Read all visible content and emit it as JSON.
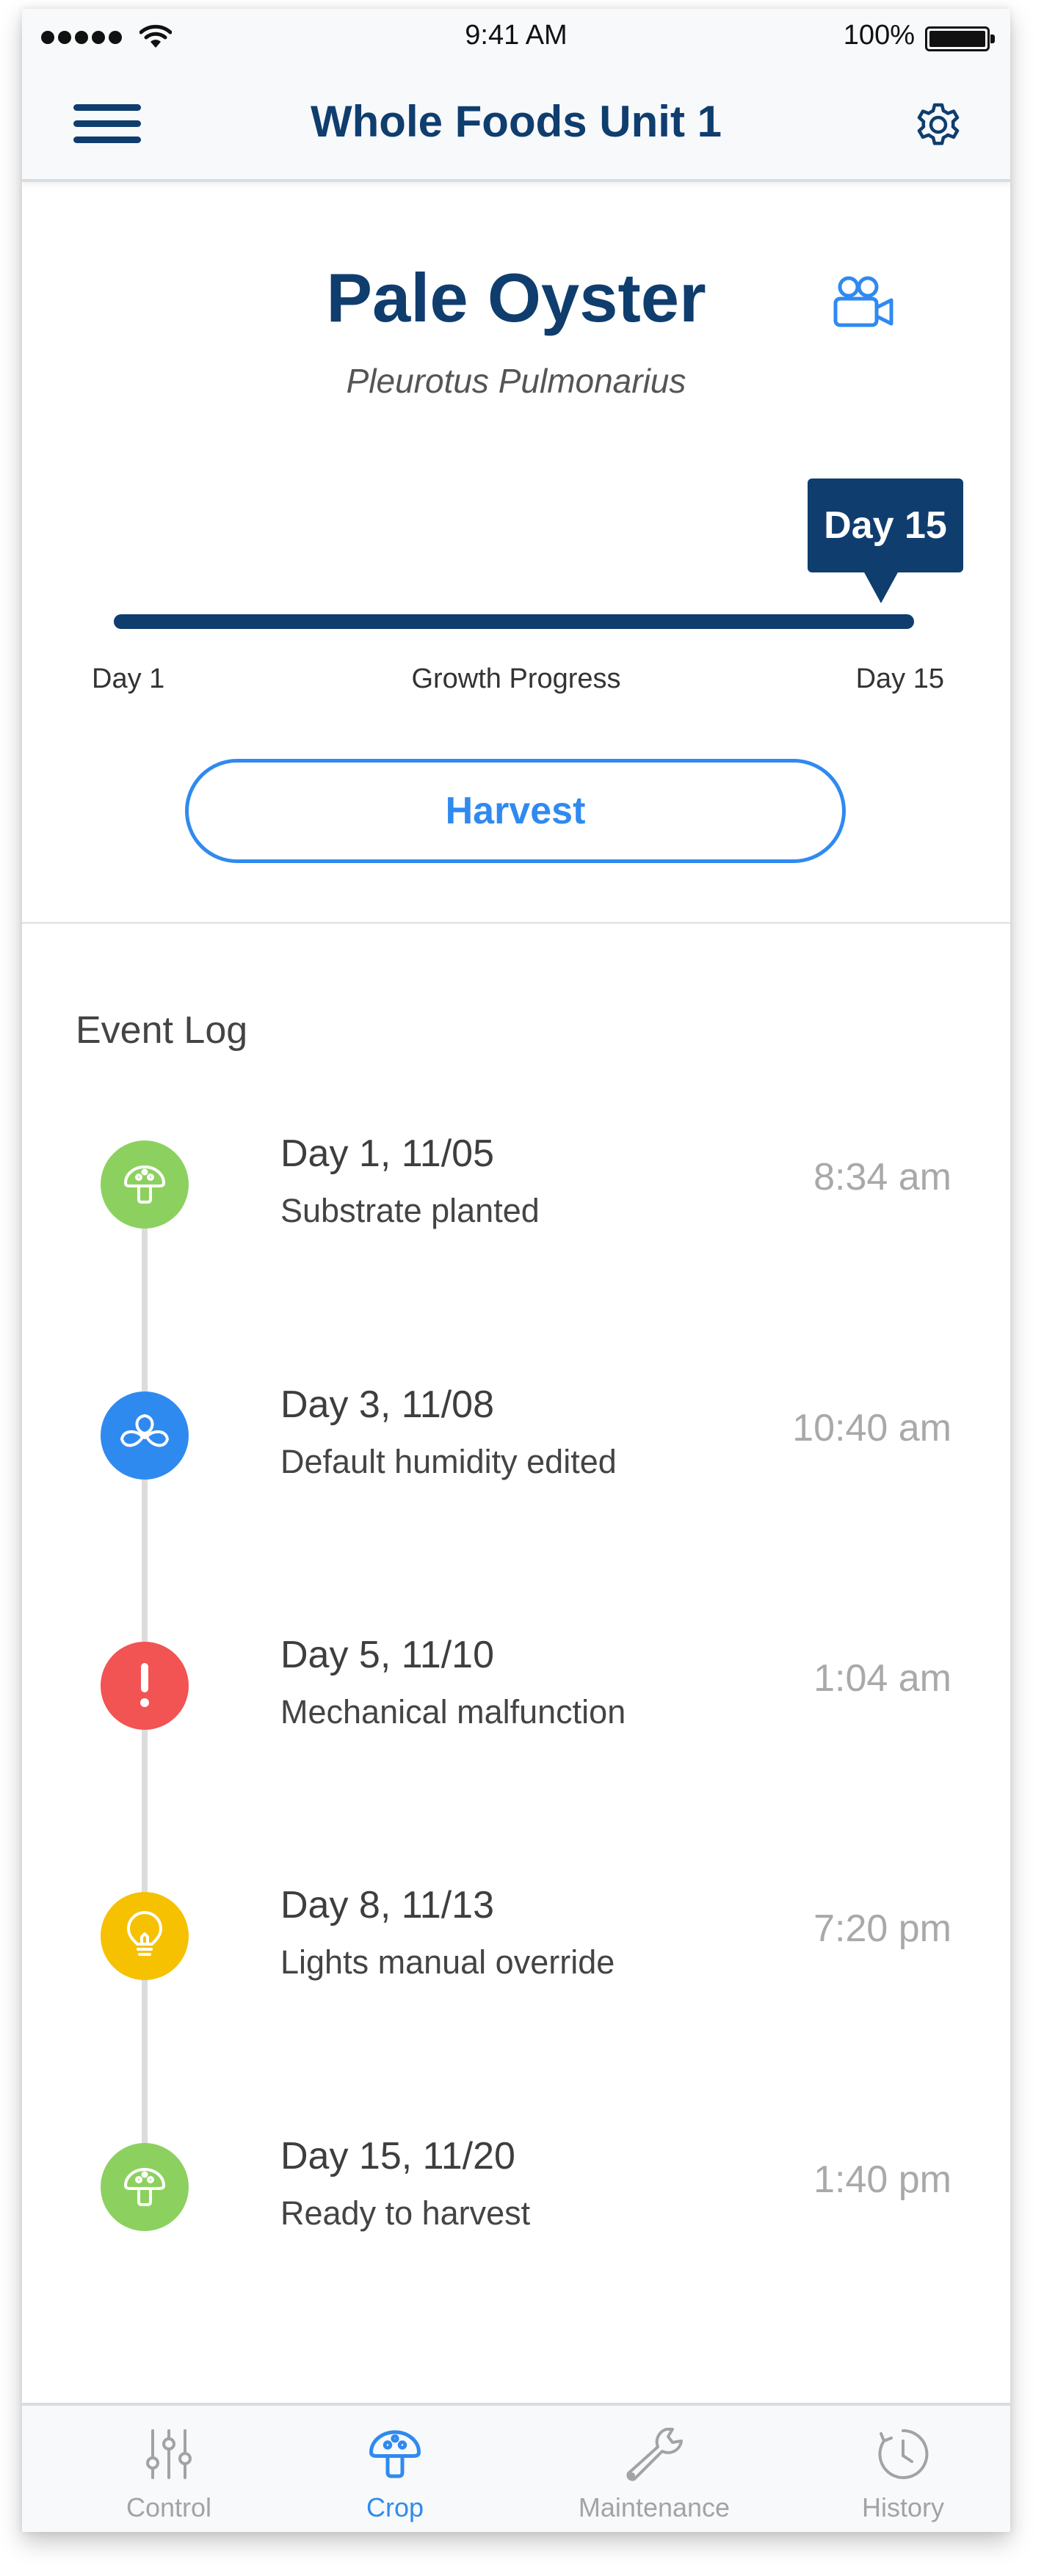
{
  "status_bar": {
    "time": "9:41 AM",
    "battery": "100%",
    "battery_level": 1.0
  },
  "nav": {
    "title": "Whole Foods Unit 1",
    "menu_icon": "menu-icon",
    "settings_icon": "gear-icon"
  },
  "crop": {
    "name": "Pale Oyster",
    "scientific_name": "Pleurotus Pulmonarius",
    "camera_icon": "video-camera-icon"
  },
  "progress": {
    "current_day_label": "Day 15",
    "start_label": "Day 1",
    "label": "Growth Progress",
    "end_label": "Day 15",
    "fraction": 1.0
  },
  "harvest_button": "Harvest",
  "event_log": {
    "title": "Event Log",
    "events": [
      {
        "date": "Day 1, 11/05",
        "description": "Substrate planted",
        "time": "8:34 am",
        "icon": "mushroom-icon",
        "color": "#8cd15f"
      },
      {
        "date": "Day 3, 11/08",
        "description": "Default humidity edited",
        "time": "10:40 am",
        "icon": "fan-icon",
        "color": "#2f8af0"
      },
      {
        "date": "Day 5, 11/10",
        "description": "Mechanical malfunction",
        "time": "1:04 am",
        "icon": "alert-icon",
        "color": "#f25353"
      },
      {
        "date": "Day 8, 11/13",
        "description": "Lights manual override",
        "time": "7:20 pm",
        "icon": "lightbulb-icon",
        "color": "#f5c100"
      },
      {
        "date": "Day 15, 11/20",
        "description": "Ready to harvest",
        "time": "1:40 pm",
        "icon": "mushroom-icon",
        "color": "#8cd15f"
      }
    ]
  },
  "tabs": [
    {
      "label": "Control",
      "icon": "sliders-icon",
      "active": false
    },
    {
      "label": "Crop",
      "icon": "mushroom-icon",
      "active": true
    },
    {
      "label": "Maintenance",
      "icon": "wrench-icon",
      "active": false
    },
    {
      "label": "History",
      "icon": "clock-history-icon",
      "active": false
    }
  ],
  "colors": {
    "primary": "#0f3d6e",
    "accent": "#2f8af0",
    "muted": "#a3a3a3"
  }
}
